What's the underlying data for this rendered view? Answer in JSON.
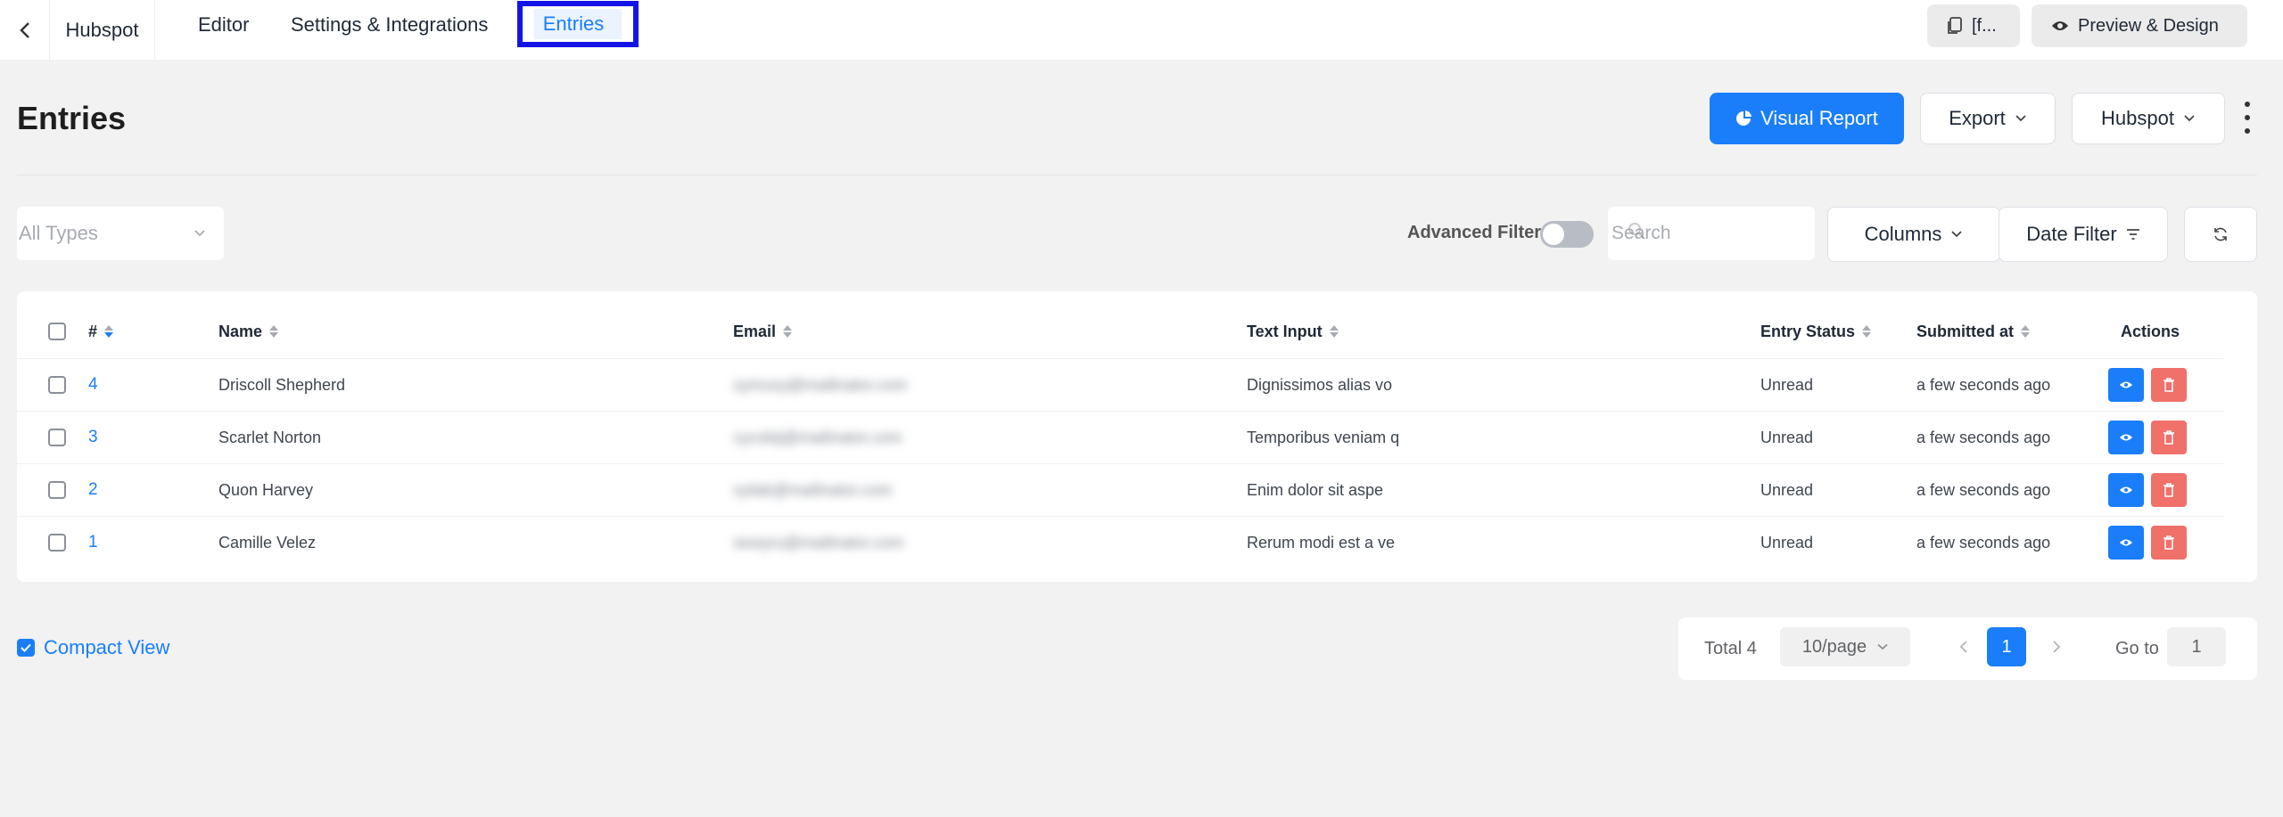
{
  "nav": {
    "brand": "Hubspot",
    "tabs": [
      {
        "label": "Editor"
      },
      {
        "label": "Settings & Integrations"
      },
      {
        "label": "Entries"
      }
    ],
    "shortcode_label": "[f...",
    "preview_label": "Preview & Design"
  },
  "header": {
    "title": "Entries",
    "visual_report": "Visual Report",
    "export": "Export",
    "integration": "Hubspot"
  },
  "filters": {
    "types_placeholder": "All Types",
    "advanced_filter_label": "Advanced Filter",
    "advanced_filter_on": false,
    "search_placeholder": "Search",
    "columns_label": "Columns",
    "date_filter_label": "Date Filter"
  },
  "table": {
    "columns": [
      "#",
      "Name",
      "Email",
      "Text Input",
      "Entry Status",
      "Submitted at",
      "Actions"
    ],
    "rows": [
      {
        "id": "4",
        "name": "Driscoll Shepherd",
        "email": "zymuxy@mailinator.com",
        "text_input": "Dignissimos alias vo",
        "status": "Unread",
        "submitted": "a few seconds ago"
      },
      {
        "id": "3",
        "name": "Scarlet Norton",
        "email": "cycobij@mailinator.com",
        "text_input": "Temporibus veniam q",
        "status": "Unread",
        "submitted": "a few seconds ago"
      },
      {
        "id": "2",
        "name": "Quon Harvey",
        "email": "rydak@mailinator.com",
        "text_input": "Enim dolor sit aspe",
        "status": "Unread",
        "submitted": "a few seconds ago"
      },
      {
        "id": "1",
        "name": "Camille Velez",
        "email": "sewyru@mailinator.com",
        "text_input": "Rerum modi est a ve",
        "status": "Unread",
        "submitted": "a few seconds ago"
      }
    ]
  },
  "footer": {
    "compact_view_label": "Compact View",
    "compact_view_checked": true,
    "total_label": "Total 4",
    "page_size": "10/page",
    "current_page": "1",
    "goto_label": "Go to",
    "goto_value": "1"
  },
  "colors": {
    "primary": "#1a7efb",
    "danger": "#f0706a",
    "highlight_border": "#1414e6"
  },
  "icons": [
    "chevron-left-icon",
    "document-icon",
    "eye-icon",
    "pie-chart-icon",
    "chevron-down-icon",
    "kebab-icon",
    "search-icon",
    "filter-lines-icon",
    "refresh-icon",
    "sort-icon",
    "trash-icon",
    "checkmark-icon",
    "chevron-right-icon"
  ]
}
